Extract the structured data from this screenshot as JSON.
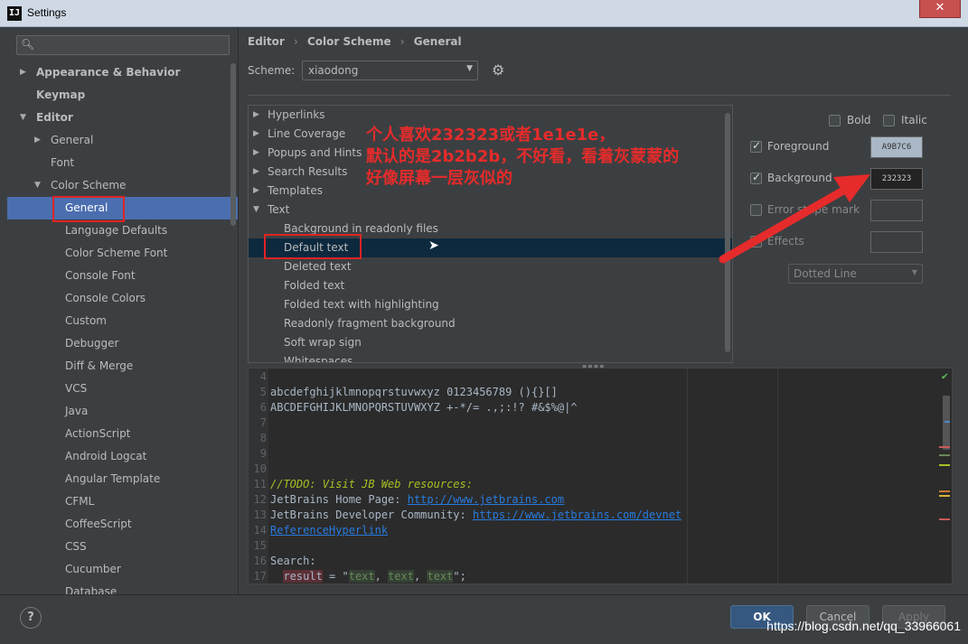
{
  "window": {
    "title": "Settings",
    "app_icon": "IJ"
  },
  "sidebar": {
    "search_placeholder": "",
    "items": [
      {
        "label": "Appearance & Behavior",
        "bold": true,
        "arrow": "▶",
        "indent": 0
      },
      {
        "label": "Keymap",
        "bold": true,
        "arrow": "",
        "indent": 0
      },
      {
        "label": "Editor",
        "bold": true,
        "arrow": "▼",
        "indent": 0
      },
      {
        "label": "General",
        "bold": false,
        "arrow": "▶",
        "indent": 1
      },
      {
        "label": "Font",
        "bold": false,
        "arrow": "",
        "indent": 1
      },
      {
        "label": "Color Scheme",
        "bold": false,
        "arrow": "▼",
        "indent": 1
      },
      {
        "label": "General",
        "bold": false,
        "arrow": "",
        "indent": 2,
        "selected": true
      },
      {
        "label": "Language Defaults",
        "indent": 2
      },
      {
        "label": "Color Scheme Font",
        "indent": 2
      },
      {
        "label": "Console Font",
        "indent": 2
      },
      {
        "label": "Console Colors",
        "indent": 2
      },
      {
        "label": "Custom",
        "indent": 2
      },
      {
        "label": "Debugger",
        "indent": 2
      },
      {
        "label": "Diff & Merge",
        "indent": 2
      },
      {
        "label": "VCS",
        "indent": 2
      },
      {
        "label": "Java",
        "indent": 2
      },
      {
        "label": "ActionScript",
        "indent": 2
      },
      {
        "label": "Android Logcat",
        "indent": 2
      },
      {
        "label": "Angular Template",
        "indent": 2
      },
      {
        "label": "CFML",
        "indent": 2
      },
      {
        "label": "CoffeeScript",
        "indent": 2
      },
      {
        "label": "CSS",
        "indent": 2
      },
      {
        "label": "Cucumber",
        "indent": 2
      },
      {
        "label": "Database",
        "indent": 2
      }
    ]
  },
  "breadcrumb": {
    "a": "Editor",
    "b": "Color Scheme",
    "c": "General",
    "sep": "›"
  },
  "scheme": {
    "label": "Scheme:",
    "value": "xiaodong"
  },
  "options": [
    {
      "label": "Hyperlinks",
      "arrow": "▶",
      "indent": 0
    },
    {
      "label": "Line Coverage",
      "arrow": "▶",
      "indent": 0
    },
    {
      "label": "Popups and Hints",
      "arrow": "▶",
      "indent": 0
    },
    {
      "label": "Search Results",
      "arrow": "▶",
      "indent": 0
    },
    {
      "label": "Templates",
      "arrow": "▶",
      "indent": 0
    },
    {
      "label": "Text",
      "arrow": "▼",
      "indent": 0
    },
    {
      "label": "Background in readonly files",
      "arrow": "",
      "indent": 1
    },
    {
      "label": "Default text",
      "arrow": "",
      "indent": 1,
      "selected": true
    },
    {
      "label": "Deleted text",
      "arrow": "",
      "indent": 1
    },
    {
      "label": "Folded text",
      "arrow": "",
      "indent": 1
    },
    {
      "label": "Folded text with highlighting",
      "arrow": "",
      "indent": 1
    },
    {
      "label": "Readonly fragment background",
      "arrow": "",
      "indent": 1
    },
    {
      "label": "Soft wrap sign",
      "arrow": "",
      "indent": 1
    },
    {
      "label": "Whitespaces",
      "arrow": "",
      "indent": 1
    }
  ],
  "annotation": {
    "line1": "个人喜欢232323或者1e1e1e，",
    "line2": "默认的是2b2b2b，不好看，看着灰蒙蒙的",
    "line3": "好像屏幕一层灰似的"
  },
  "attributes": {
    "bold": "Bold",
    "italic": "Italic",
    "foreground": {
      "label": "Foreground",
      "value": "A9B7C6",
      "checked": true,
      "color": "#a9b7c6"
    },
    "background": {
      "label": "Background",
      "value": "232323",
      "checked": true,
      "color": "#232323"
    },
    "error_stripe": "Error stripe mark",
    "effects": "Effects",
    "effect_type": "Dotted Line"
  },
  "editor": {
    "lines": [
      {
        "n": "4",
        "html": ""
      },
      {
        "n": "5",
        "text": "abcdefghijklmnopqrstuvwxyz 0123456789 (){}[]"
      },
      {
        "n": "6",
        "text": "ABCDEFGHIJKLMNOPQRSTUVWXYZ +-*/= .,;:!? #&$%@|^"
      },
      {
        "n": "7",
        "text": ""
      },
      {
        "n": "8",
        "text": ""
      },
      {
        "n": "9",
        "text": ""
      },
      {
        "n": "10",
        "text": ""
      },
      {
        "n": "11",
        "todo": "//TODO: Visit JB Web resources:"
      },
      {
        "n": "12",
        "text": "JetBrains Home Page: ",
        "link": "http://www.jetbrains.com"
      },
      {
        "n": "13",
        "text": "JetBrains Developer Community: ",
        "link": "https://www.jetbrains.com/devnet"
      },
      {
        "n": "14",
        "link": "ReferenceHyperlink"
      },
      {
        "n": "15",
        "text": ""
      },
      {
        "n": "16",
        "text": "Search:"
      },
      {
        "n": "17",
        "search": true
      }
    ],
    "search_line": {
      "var": "result",
      "eq": " = \"",
      "t": "text",
      "comma": ", ",
      "end": "\";"
    }
  },
  "buttons": {
    "ok": "OK",
    "cancel": "Cancel",
    "apply": "Apply",
    "help": "?"
  },
  "watermark": "https://blog.csdn.net/qq_33966061"
}
